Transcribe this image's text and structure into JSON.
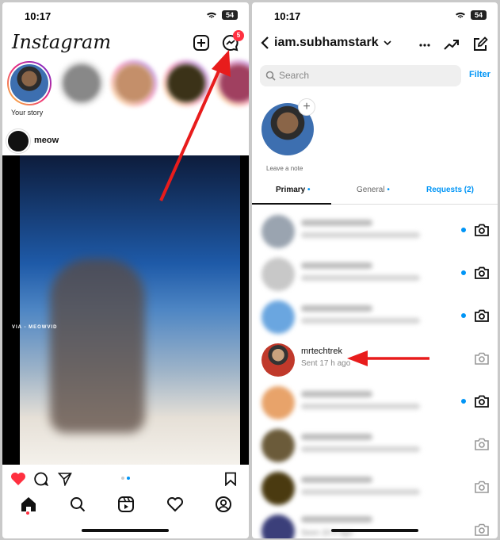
{
  "left": {
    "status": {
      "time": "10:17",
      "battery": "54"
    },
    "app_title": "Instagram",
    "messages_badge": "5",
    "your_story_label": "Your story",
    "post_user": "meow",
    "post_watermark": "VIA - MEOWVID"
  },
  "right": {
    "status": {
      "time": "10:17",
      "battery": "54"
    },
    "username": "iam.subhamstark",
    "search_placeholder": "Search",
    "filter_label": "Filter",
    "note_label": "Leave a note",
    "tabs": [
      {
        "label": "Primary"
      },
      {
        "label": "General"
      },
      {
        "label": "Requests (2)"
      }
    ],
    "highlighted_chat": {
      "name": "mrtechtrek",
      "status": "Sent 17 h ago"
    },
    "last_row_status": "Seen 20 h ago"
  },
  "colors": {
    "accent": "#0095f6",
    "badge": "#ff3040",
    "arrow": "#e81c1c"
  }
}
